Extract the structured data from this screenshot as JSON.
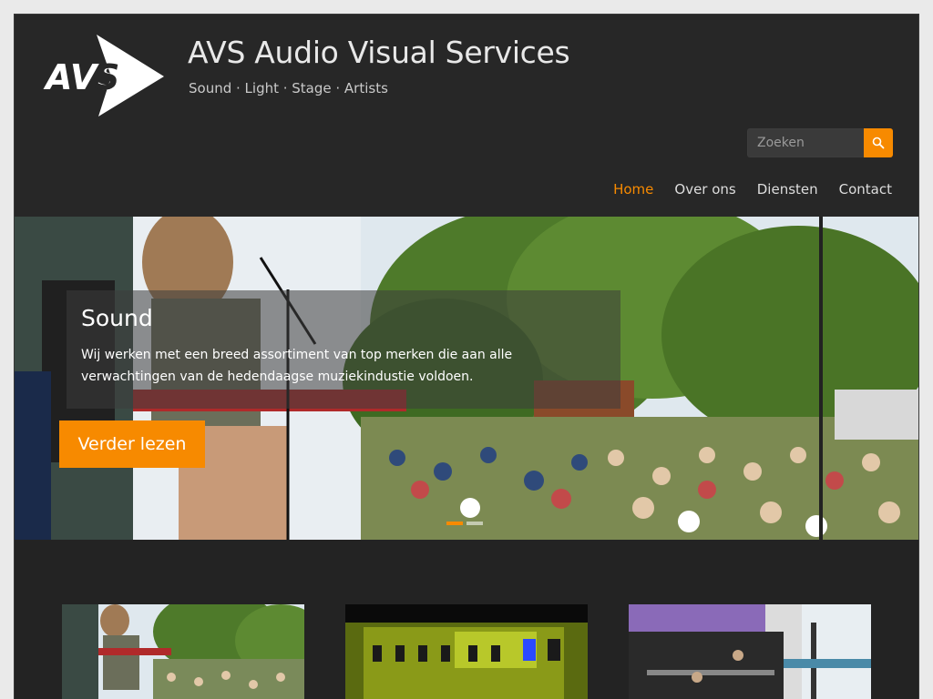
{
  "header": {
    "site_title": "AVS Audio Visual Services",
    "tagline": "Sound · Light · Stage · Artists",
    "logo_text": "AVS"
  },
  "search": {
    "placeholder": "Zoeken",
    "icon": "search-icon"
  },
  "nav": {
    "items": [
      {
        "label": "Home",
        "active": true
      },
      {
        "label": "Over ons",
        "active": false
      },
      {
        "label": "Diensten",
        "active": false
      },
      {
        "label": "Contact",
        "active": false
      }
    ]
  },
  "slider": {
    "title": "Sound",
    "text": "Wij werken met een breed assortiment van top merken die aan alle verwachtingen van de hedendaagse muziekindustie voldoen.",
    "button_label": "Verder lezen",
    "slide_count": 2,
    "active_slide": 1
  },
  "colors": {
    "accent": "#f78a00",
    "header_bg": "#272727",
    "body_bg": "#232323"
  }
}
